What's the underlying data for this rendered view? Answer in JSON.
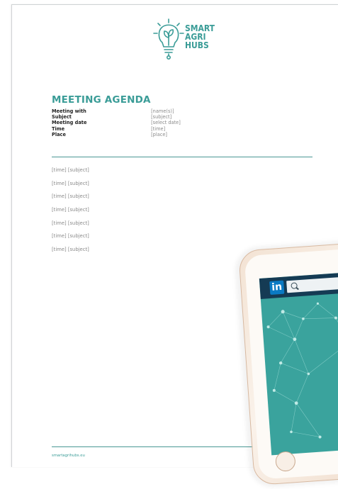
{
  "logo": {
    "line1": "SMART",
    "line2": "AGRI",
    "line3": "HUBS",
    "icon": "lightbulb-sprout-icon",
    "color": "#3a9c97"
  },
  "agenda": {
    "title": "MEETING AGENDA",
    "fields": [
      {
        "label": "Meeting with",
        "value": "[name(s)]"
      },
      {
        "label": "Subject",
        "value": "[subject]"
      },
      {
        "label": "Meeting date",
        "value": "[select date]"
      },
      {
        "label": "Time",
        "value": "[time]"
      },
      {
        "label": "Place",
        "value": "[place]"
      }
    ],
    "items": [
      "[time] [subject]",
      "[time] [subject]",
      "[time] [subject]",
      "[time] [subject]",
      "[time] [subject]",
      "[time] [subject]",
      "[time] [subject]"
    ]
  },
  "footer": {
    "url": "smartagrihubs.eu"
  },
  "tablet": {
    "app_logo": "in",
    "app_icon": "linkedin-icon",
    "search_icon": "search-icon",
    "screen_color": "#3aa39d",
    "bar_color": "#153b54"
  }
}
